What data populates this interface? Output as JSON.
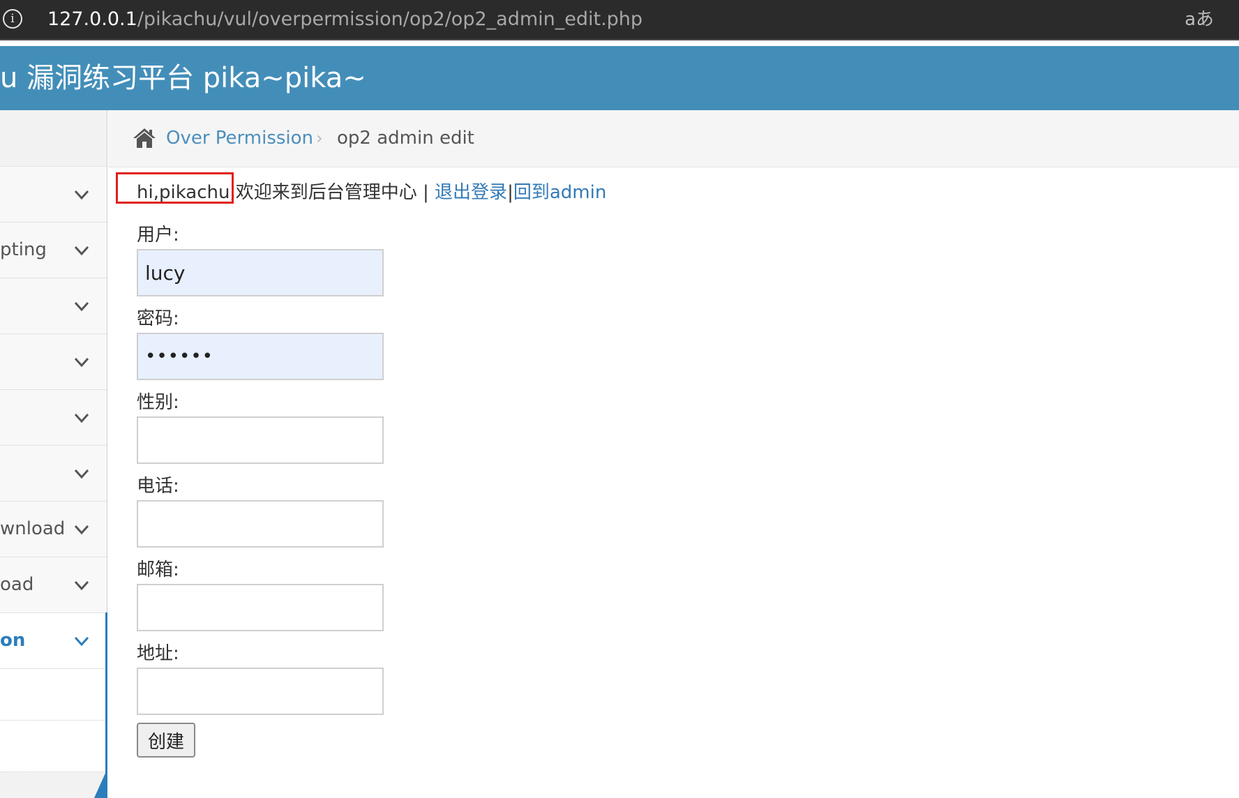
{
  "browser": {
    "url_host": "127.0.0.1",
    "url_path": "/pikachu/vul/overpermission/op2/op2_admin_edit.php",
    "info_icon": "info-icon",
    "translate_icon": "translate-icon",
    "translate_glyph": "aあ"
  },
  "header": {
    "title": "u 漏洞练习平台 pika~pika~"
  },
  "sidebar": {
    "items": [
      {
        "label": ""
      },
      {
        "label": "pting"
      },
      {
        "label": ""
      },
      {
        "label": ""
      },
      {
        "label": ""
      },
      {
        "label": ""
      },
      {
        "label": "wnload"
      },
      {
        "label": "oad"
      },
      {
        "label": "on",
        "active": true
      }
    ]
  },
  "breadcrumb": {
    "home_icon": "home-icon",
    "link": "Over Permission",
    "separator": "›",
    "current": "op2 admin edit"
  },
  "welcome": {
    "greeting": "hi,pikachu,",
    "message": "欢迎来到后台管理中心 | ",
    "logout": "退出登录",
    "divider": "|",
    "back_admin": "回到admin"
  },
  "form": {
    "username_label": "用户:",
    "username_value": "lucy",
    "password_label": "密码:",
    "password_value": "123456",
    "sex_label": "性别:",
    "sex_value": "",
    "phone_label": "电话:",
    "phone_value": "",
    "email_label": "邮箱:",
    "email_value": "",
    "address_label": "地址:",
    "address_value": "",
    "submit_label": "创建"
  },
  "colors": {
    "header_bg": "#438eb9",
    "link": "#337ab7",
    "highlight_box": "#e0201b",
    "autofill_bg": "#e8f0fe"
  }
}
